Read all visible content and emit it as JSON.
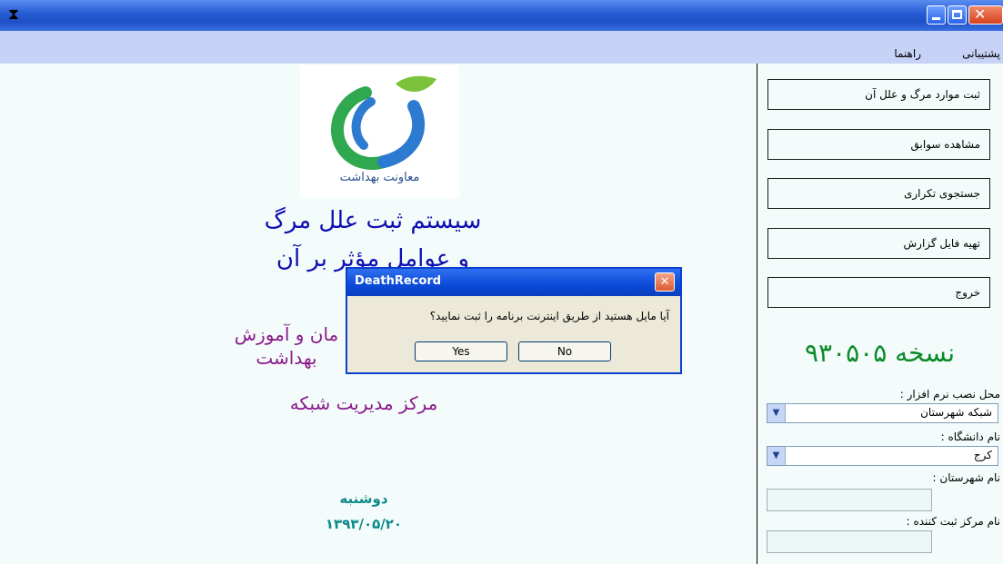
{
  "window": {
    "app_icon": "hourglass-icon"
  },
  "menu": {
    "items": [
      "پشتیبانی",
      "راهنما"
    ]
  },
  "sidebar": {
    "buttons": [
      "ثبت موارد مرگ و علل آن",
      "مشاهده سوابق",
      "جستجوی تکراری",
      "تهیه فایل گزارش",
      "خروج"
    ],
    "version": "نسخه ۹۳۰۵۰۵",
    "install_location_label": "محل نصب نرم افزار :",
    "install_location_value": "شبکه شهرستان",
    "university_label": "نام دانشگاه :",
    "university_value": "کرج",
    "city_label": "نام شهرستان :",
    "city_value": "",
    "registrar_label": "نام مرکز ثبت کننده :",
    "registrar_value": ""
  },
  "main": {
    "logo_caption": "معاونت بهداشت",
    "title_line1": "سیستم ثبت علل مرگ",
    "title_line2": "و عوامل مؤثر بر آن",
    "org_line1": "مان و آموزش",
    "org_line2": "بهداشت",
    "center_name": "مرکز مدیریت شبکه",
    "weekday": "دوشنبه",
    "date": "۱۳۹۳/۰۵/۲۰"
  },
  "dialog": {
    "title": "DeathRecord",
    "message": "آیا مایل هستید از طریق اینترنت برنامه را ثبت نمایید؟",
    "yes_label": "Yes",
    "no_label": "No"
  },
  "colors": {
    "title_blue": "#1010b0",
    "purple": "#8b1a8b",
    "version_green": "#0b8a28",
    "date_teal": "#0c8a8a"
  }
}
